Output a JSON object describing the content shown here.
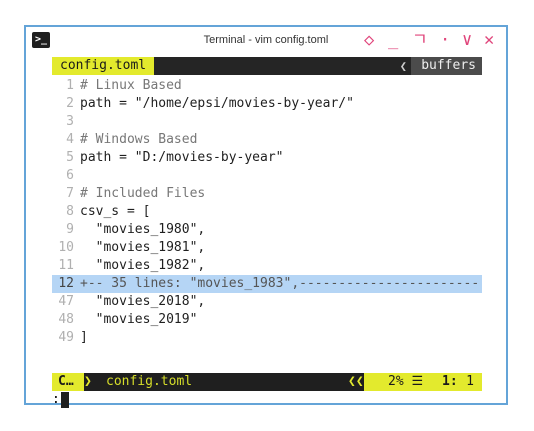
{
  "window": {
    "title": "Terminal - vim config.toml",
    "icon": "terminal-icon",
    "border_color": "#64a4d8",
    "controls": [
      {
        "name": "diamond-icon",
        "glyph": "◇"
      },
      {
        "name": "minimize-icon",
        "glyph": "_"
      },
      {
        "name": "maximize-icon",
        "glyph": "ㄱ"
      },
      {
        "name": "dot-icon",
        "glyph": "·"
      },
      {
        "name": "chevron-down-icon",
        "glyph": "∨"
      },
      {
        "name": "close-icon",
        "glyph": "✕"
      }
    ]
  },
  "tabline": {
    "active_tab": "config.toml",
    "buffers_label": "buffers",
    "buffers_arrow": "❮"
  },
  "lines": [
    {
      "num": "1",
      "text": "# Linux Based",
      "type": "comment"
    },
    {
      "num": "2",
      "text": "path = \"/home/epsi/movies-by-year/\"",
      "type": "code"
    },
    {
      "num": "3",
      "text": "",
      "type": "code"
    },
    {
      "num": "4",
      "text": "# Windows Based",
      "type": "comment"
    },
    {
      "num": "5",
      "text": "path = \"D:/movies-by-year\"",
      "type": "code"
    },
    {
      "num": "6",
      "text": "",
      "type": "code"
    },
    {
      "num": "7",
      "text": "# Included Files",
      "type": "comment"
    },
    {
      "num": "8",
      "text": "csv_s = [",
      "type": "code"
    },
    {
      "num": "9",
      "text": "  \"movies_1980\",",
      "type": "code"
    },
    {
      "num": "10",
      "text": "  \"movies_1981\",",
      "type": "code"
    },
    {
      "num": "11",
      "text": "  \"movies_1982\",",
      "type": "code"
    },
    {
      "num": "12",
      "text": "+-- 35 lines: \"movies_1983\",-----------------------",
      "type": "fold"
    },
    {
      "num": "47",
      "text": "  \"movies_2018\",",
      "type": "code"
    },
    {
      "num": "48",
      "text": "  \"movies_2019\"",
      "type": "code"
    },
    {
      "num": "49",
      "text": "]",
      "type": "code"
    }
  ],
  "statusline": {
    "mode": "C…",
    "arrow": "❯",
    "filename": "config.toml",
    "left_arrows": "❮❮",
    "percent": "2% ☰",
    "line": "1:",
    "col": "1"
  },
  "cmdline": {
    "prompt": ":"
  },
  "colors": {
    "accent_yellow": "#e3ea2d",
    "fold_bg": "#b5d5f5",
    "statusline_bg": "#1f1f1f",
    "controls_pink": "#e0457b"
  }
}
